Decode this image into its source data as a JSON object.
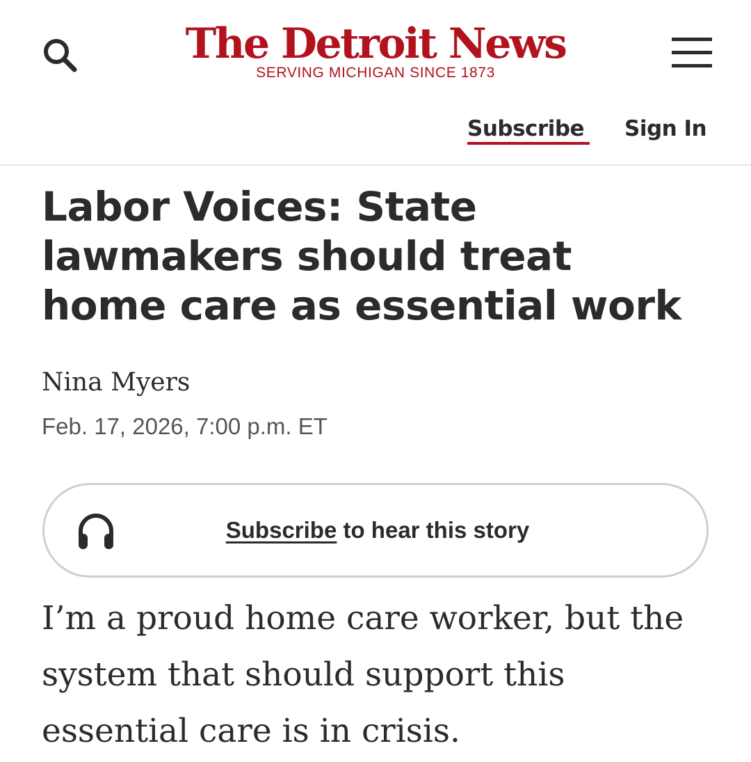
{
  "header": {
    "logo_title": "The Detroit News",
    "logo_tagline": "SERVING MICHIGAN SINCE 1873",
    "search_icon": "search-icon",
    "menu_icon": "hamburger-menu-icon",
    "subscribe_label": "Subscribe",
    "signin_label": "Sign In"
  },
  "article": {
    "headline": "Labor Voices: State lawmakers should treat home care as essential work",
    "author": "Nina Myers",
    "date": "Feb. 17, 2026, 7:00 p.m. ET",
    "audio": {
      "icon": "headphones-icon",
      "link_label": "Subscribe",
      "suffix": " to hear this story"
    },
    "body_paragraph": "I’m a proud home care worker, but the system that should support this essential care is in crisis."
  },
  "colors": {
    "brand_red": "#b2121e",
    "text": "#2b2b2b",
    "muted": "#555555",
    "divider": "#e3e3e3"
  }
}
